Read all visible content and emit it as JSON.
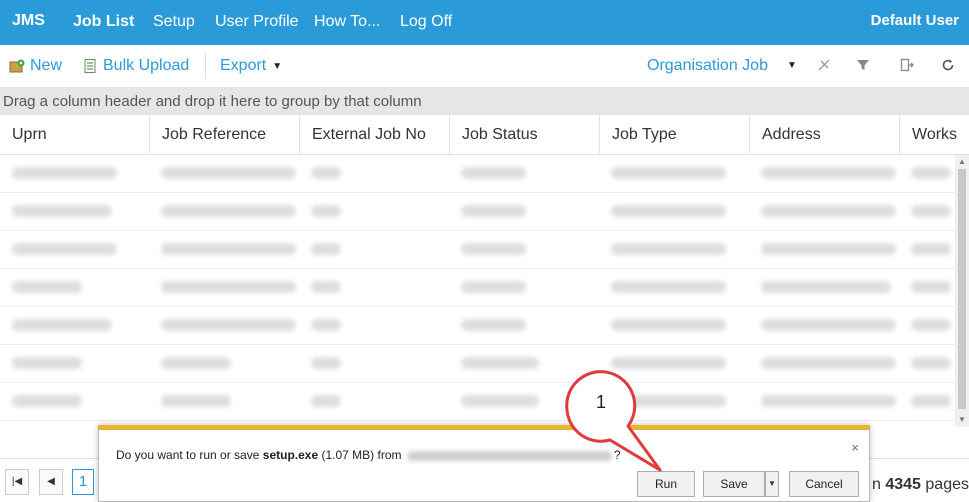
{
  "topnav": {
    "brand": "JMS",
    "items": [
      {
        "label": "Job List",
        "active": true
      },
      {
        "label": "Setup",
        "active": false
      },
      {
        "label": "User Profile",
        "active": false
      },
      {
        "label": "How To...",
        "active": false
      },
      {
        "label": "Log Off",
        "active": false
      }
    ],
    "user": "Default User",
    "color": "#2a9bd8"
  },
  "toolbar": {
    "new_label": "New",
    "bulk_upload_label": "Bulk Upload",
    "export_label": "Export",
    "view_select": "Organisation Job",
    "icons": [
      "clear-filter-icon",
      "filter-icon",
      "export-columns-icon",
      "refresh-icon"
    ]
  },
  "group_panel": {
    "hint": "Drag a column header and drop it here to group by that column"
  },
  "grid": {
    "columns": [
      "Uprn",
      "Job Reference",
      "External Job No",
      "Job Status",
      "Job Type",
      "Address",
      "Works"
    ],
    "rows_note_hidden": true
  },
  "pager": {
    "current_page": "1",
    "info_prefix": "n",
    "total_pages": "4345",
    "info_suffix": "pages"
  },
  "download_bar": {
    "message_prefix": "Do you want to run or save",
    "file_name": "setup.exe",
    "file_size": "(1.07 MB) from",
    "message_suffix": "?",
    "close": "×",
    "run_label": "Run",
    "save_label": "Save",
    "cancel_label": "Cancel",
    "accent": "#e8b42a"
  },
  "callout": {
    "number": "1",
    "color": "#e03a3a"
  }
}
